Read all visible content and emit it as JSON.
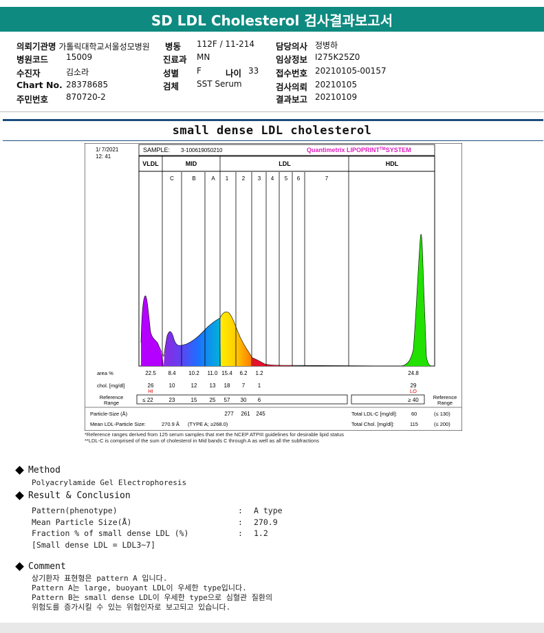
{
  "header": {
    "title": "SD LDL Cholesterol 검사결과보고서"
  },
  "info": {
    "c1": [
      {
        "label": "의뢰기관명",
        "value": "가톨릭대학교서울성모병원"
      },
      {
        "label": "병원코드",
        "value": "15009"
      },
      {
        "label": "수진자",
        "value": "김소라"
      },
      {
        "label": "Chart No.",
        "value": "28378685"
      },
      {
        "label": "주민번호",
        "value": "870720-2"
      }
    ],
    "c2": [
      {
        "label": "병동",
        "value": "112F / 11-214"
      },
      {
        "label": "진료과",
        "value": "MN"
      },
      {
        "label": "성별",
        "value": "F"
      },
      {
        "label": "검체",
        "value": "SST Serum"
      }
    ],
    "age": {
      "label": "나이",
      "value": "33"
    },
    "c3": [
      {
        "label": "담당의사",
        "value": "정병하"
      },
      {
        "label": "임상정보",
        "value": "I275K25Z0"
      },
      {
        "label": "접수번호",
        "value": "20210105-00157"
      },
      {
        "label": "검사의뢰",
        "value": "20210105"
      },
      {
        "label": "결과보고",
        "value": "20210109"
      }
    ]
  },
  "section_title": "small dense LDL cholesterol",
  "report": {
    "date": "1/ 7/2021",
    "time": "12: 41",
    "sample_label": "SAMPLE:",
    "sample_id": "3-100619050210",
    "brand": "Quantimetrix LIPOPRINT",
    "brand_tm": "TM",
    "brand_suffix": "SYSTEM",
    "groups": [
      "VLDL",
      "MID",
      "LDL",
      "HDL"
    ],
    "bands": [
      "C",
      "B",
      "A",
      "1",
      "2",
      "3",
      "4",
      "5",
      "6",
      "7"
    ],
    "row_labels": {
      "area": "area %",
      "chol": "chol. [mg/dl]",
      "ref1": "Reference",
      "ref2": "Range",
      "particle": "Particle-Size (Å)",
      "mean": "Mean LDL-Particle Size:"
    },
    "area": [
      "22.5",
      "8.4",
      "10.2",
      "11.0",
      "15.4",
      "6.2",
      "1.2",
      "24.8"
    ],
    "chol": [
      "26",
      "10",
      "12",
      "13",
      "18",
      "7",
      "1",
      "29"
    ],
    "flags": {
      "vldl": "HI",
      "hdl": "LO"
    },
    "ref": [
      "≤ 22",
      "23",
      "15",
      "25",
      "57",
      "30",
      "6"
    ],
    "ref_hdl": "≥ 40",
    "particle_size": [
      "277",
      "261",
      "245"
    ],
    "mean_value": "270.9 Å",
    "mean_type": "(TYPE A; ≥268.0)",
    "total_ldl_label": "Total LDL-C [mg/dl]:",
    "total_ldl_value": "60",
    "total_ldl_ref": "(≤ 130)",
    "total_chol_label": "Total Chol. [mg/dl]:",
    "total_chol_value": "115",
    "total_chol_ref": "(≤ 200)",
    "footnote1": "*Reference ranges derived from 125 serum samples that met the NCEP ATPIII guidelines for desirable lipid status",
    "footnote2": "**LDL-C is comprised of the sum of cholesterol in Mid bands C through A as well as all the subfractions"
  },
  "method": {
    "heading": "Method",
    "text": "Polyacrylamide Gel Electrophoresis"
  },
  "result": {
    "heading": "Result & Conclusion",
    "rows": [
      {
        "label": "Pattern(phenotype)",
        "value": "A type"
      },
      {
        "label": "Mean Particle Size(Å)",
        "value": "270.9"
      },
      {
        "label": "Fraction % of small dense LDL (%)",
        "value": "1.2"
      }
    ],
    "note": "[Small dense LDL = LDL3~7]"
  },
  "comment": {
    "heading": "Comment",
    "lines": [
      "상기환자 표현형은 pattern A 입니다.",
      "Pattern A는 large, buoyant LDL이 우세한 type입니다.",
      "Pattern B는 small dense LDL이 우세한 type으로 심혈관 질환의",
      "위험도를 증가시킬 수 있는 위험인자로 보고되고 있습니다."
    ]
  },
  "colors": {
    "header_bg": "#0e8a80",
    "rule": "#1a4c7d",
    "brand": "#e020c0",
    "vldl": "#b400ff",
    "mid_c": "#8a2be2",
    "mid_b": "#1e6fff",
    "mid_a": "#00b4d8",
    "ldl1": "#ffee00",
    "ldl2": "#ffb000",
    "ldl3": "#e8102a",
    "hdl": "#22e000",
    "flag": "#e00000"
  }
}
